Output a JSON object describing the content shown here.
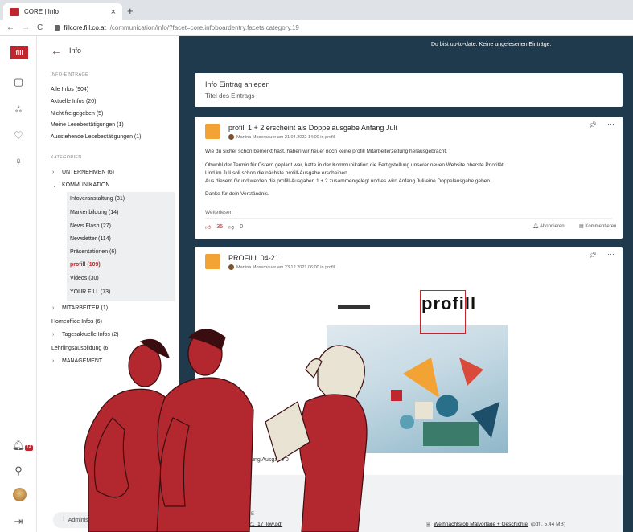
{
  "browser": {
    "tab_title": "CORE | Info",
    "new_tab": "+",
    "back": "←",
    "forward": "→",
    "reload": "C",
    "url_host": "fillcore.fill.co.at",
    "url_path": "/communication/info/?facet=core.infoboardentry.facets.category.19"
  },
  "rail": {
    "logo": "fill",
    "bell_badge": "14"
  },
  "sidebar": {
    "back_label": "Info",
    "section_info": "INFO-EINTRÄGE",
    "info_items": [
      "Alle Infos (904)",
      "Aktuelle Infos (20)",
      "Nicht freigegeben (5)",
      "Meine Lesebestätigungen (1)",
      "Ausstehende Lesebestätigungen (1)"
    ],
    "section_categories": "KATEGORIEN",
    "categories": {
      "unternehmen": "UNTERNEHMEN (6)",
      "kommunikation": "KOMMUNIKATION",
      "kommunikation_sub": [
        "Infoveranstaltung (31)",
        "Markenbildung (14)",
        "News Flash (27)",
        "Newsletter (114)",
        "Präsentationen (6)",
        "profill (109)",
        "Videos (30)",
        "YOUR FILL (73)"
      ],
      "mitarbeiter": "MITARBEITER (1)",
      "homeoffice": "Homeoffice Infos (6)",
      "tagesaktuelle": "Tagesaktuelle Infos (2)",
      "lehrlings": "Lehrlingsausbildung (6",
      "management": "MANAGEMENT"
    },
    "admin_label": "Administra"
  },
  "main": {
    "up_to_date": "Du bist up-to-date. Keine ungelesenen Einträge.",
    "create": {
      "title": "Info Eintrag anlegen",
      "placeholder": "Titel des Eintrags"
    },
    "post1": {
      "title": "profill 1 + 2 erscheint als Doppelausgabe Anfang Juli",
      "meta": "Martina Moserbauer am 21.04.2022 14:00 in profill",
      "paragraphs": [
        "Wie du sicher schon bemerkt hast, haben wir heuer noch keine profill Mitarbeiterzeitung herausgebracht.",
        "Obwohl der Termin für Ostern geplant war, hatte in der Kommunikation die Fertigstellung unserer neuen Website oberste Priorität.",
        "Und im Juli soll schon die nächste profill-Ausgabe erscheinen.",
        "Aus diesem Grund werden die profill-Ausgaben 1 + 2 zusammengelegt und es wird Anfang Juli eine Doppelausgabe geben.",
        "Danke für dein Verständnis."
      ],
      "read_more": "Weiterlesen",
      "likes": "35",
      "dislikes": "0",
      "subscribe": "Abonnieren",
      "comment": "Kommentieren"
    },
    "post2": {
      "title": "PROFILL 04-21",
      "meta": "Martina Moserbauer am 23.12.2021 06:00 in profill",
      "magazine_logo": "profill",
      "caption": "erzeitung Ausgabe 0",
      "attachments_label": "E",
      "attachment1": "2021_17_low.pdf",
      "attachment2_name": "Weihnachtsrob Malvorlage + Geschichte",
      "attachment2_size": "(pdf , 5.44 MB)"
    }
  },
  "colors": {
    "brand_red": "#c0262d",
    "dark_bg": "#1e3a4c",
    "figure_red": "#b3282e"
  }
}
